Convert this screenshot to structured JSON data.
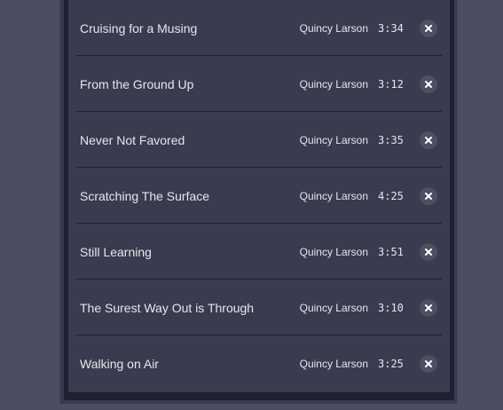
{
  "playlist": {
    "tracks": [
      {
        "title": "Cruising for a Musing",
        "artist": "Quincy Larson",
        "duration": "3:34",
        "remove_icon": "close-icon"
      },
      {
        "title": "From the Ground Up",
        "artist": "Quincy Larson",
        "duration": "3:12",
        "remove_icon": "close-icon"
      },
      {
        "title": "Never Not Favored",
        "artist": "Quincy Larson",
        "duration": "3:35",
        "remove_icon": "close-icon"
      },
      {
        "title": "Scratching The Surface",
        "artist": "Quincy Larson",
        "duration": "4:25",
        "remove_icon": "close-icon"
      },
      {
        "title": "Still Learning",
        "artist": "Quincy Larson",
        "duration": "3:51",
        "remove_icon": "close-icon"
      },
      {
        "title": "The Surest Way Out is Through",
        "artist": "Quincy Larson",
        "duration": "3:10",
        "remove_icon": "close-icon"
      },
      {
        "title": "Walking on Air",
        "artist": "Quincy Larson",
        "duration": "3:25",
        "remove_icon": "close-icon"
      }
    ]
  },
  "colors": {
    "page_background": "#4d4d62",
    "panel_background": "#1f1f32",
    "row_background": "#3b3b4f",
    "text": "#e6e6ee",
    "remove_button": "#4f4f64"
  }
}
